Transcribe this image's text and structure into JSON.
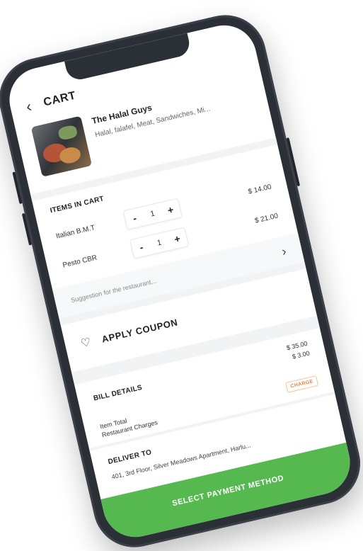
{
  "header": {
    "back_icon": "chevron-left-icon",
    "title": "CART"
  },
  "restaurant": {
    "name": "The Halal Guys",
    "tags": "Halal, falafel, Meat, Sandwiches, Mi..."
  },
  "cart": {
    "section_label": "ITEMS IN CART",
    "items": [
      {
        "name": "Italian B.M.T",
        "qty": "1",
        "price": "$ 14.00"
      },
      {
        "name": "Pesto CBR",
        "qty": "1",
        "price": "$ 21.00"
      }
    ],
    "minus_label": "-",
    "plus_label": "+"
  },
  "suggestion": {
    "placeholder": "Suggestion for the restaurant..."
  },
  "coupon": {
    "label": "APPLY COUPON",
    "icon": "tag-icon"
  },
  "bill": {
    "section_label": "BILL DETAILS",
    "item_total_label": "Item Total",
    "restaurant_charges_label": "Restaurant Charges",
    "item_total_value": "$ 35.00",
    "restaurant_charges_value": "$ 3.00",
    "badge": "CHARGE"
  },
  "deliver": {
    "section_label": "DELIVER TO",
    "address": "401, 3rd Floor, Silver Meadows Apartment, Harlu..."
  },
  "footer": {
    "pay_button": "SELECT PAYMENT METHOD"
  },
  "colors": {
    "accent_green": "#56b94f",
    "charge_orange": "#e8883a",
    "phone_frame": "#2b2f36"
  }
}
